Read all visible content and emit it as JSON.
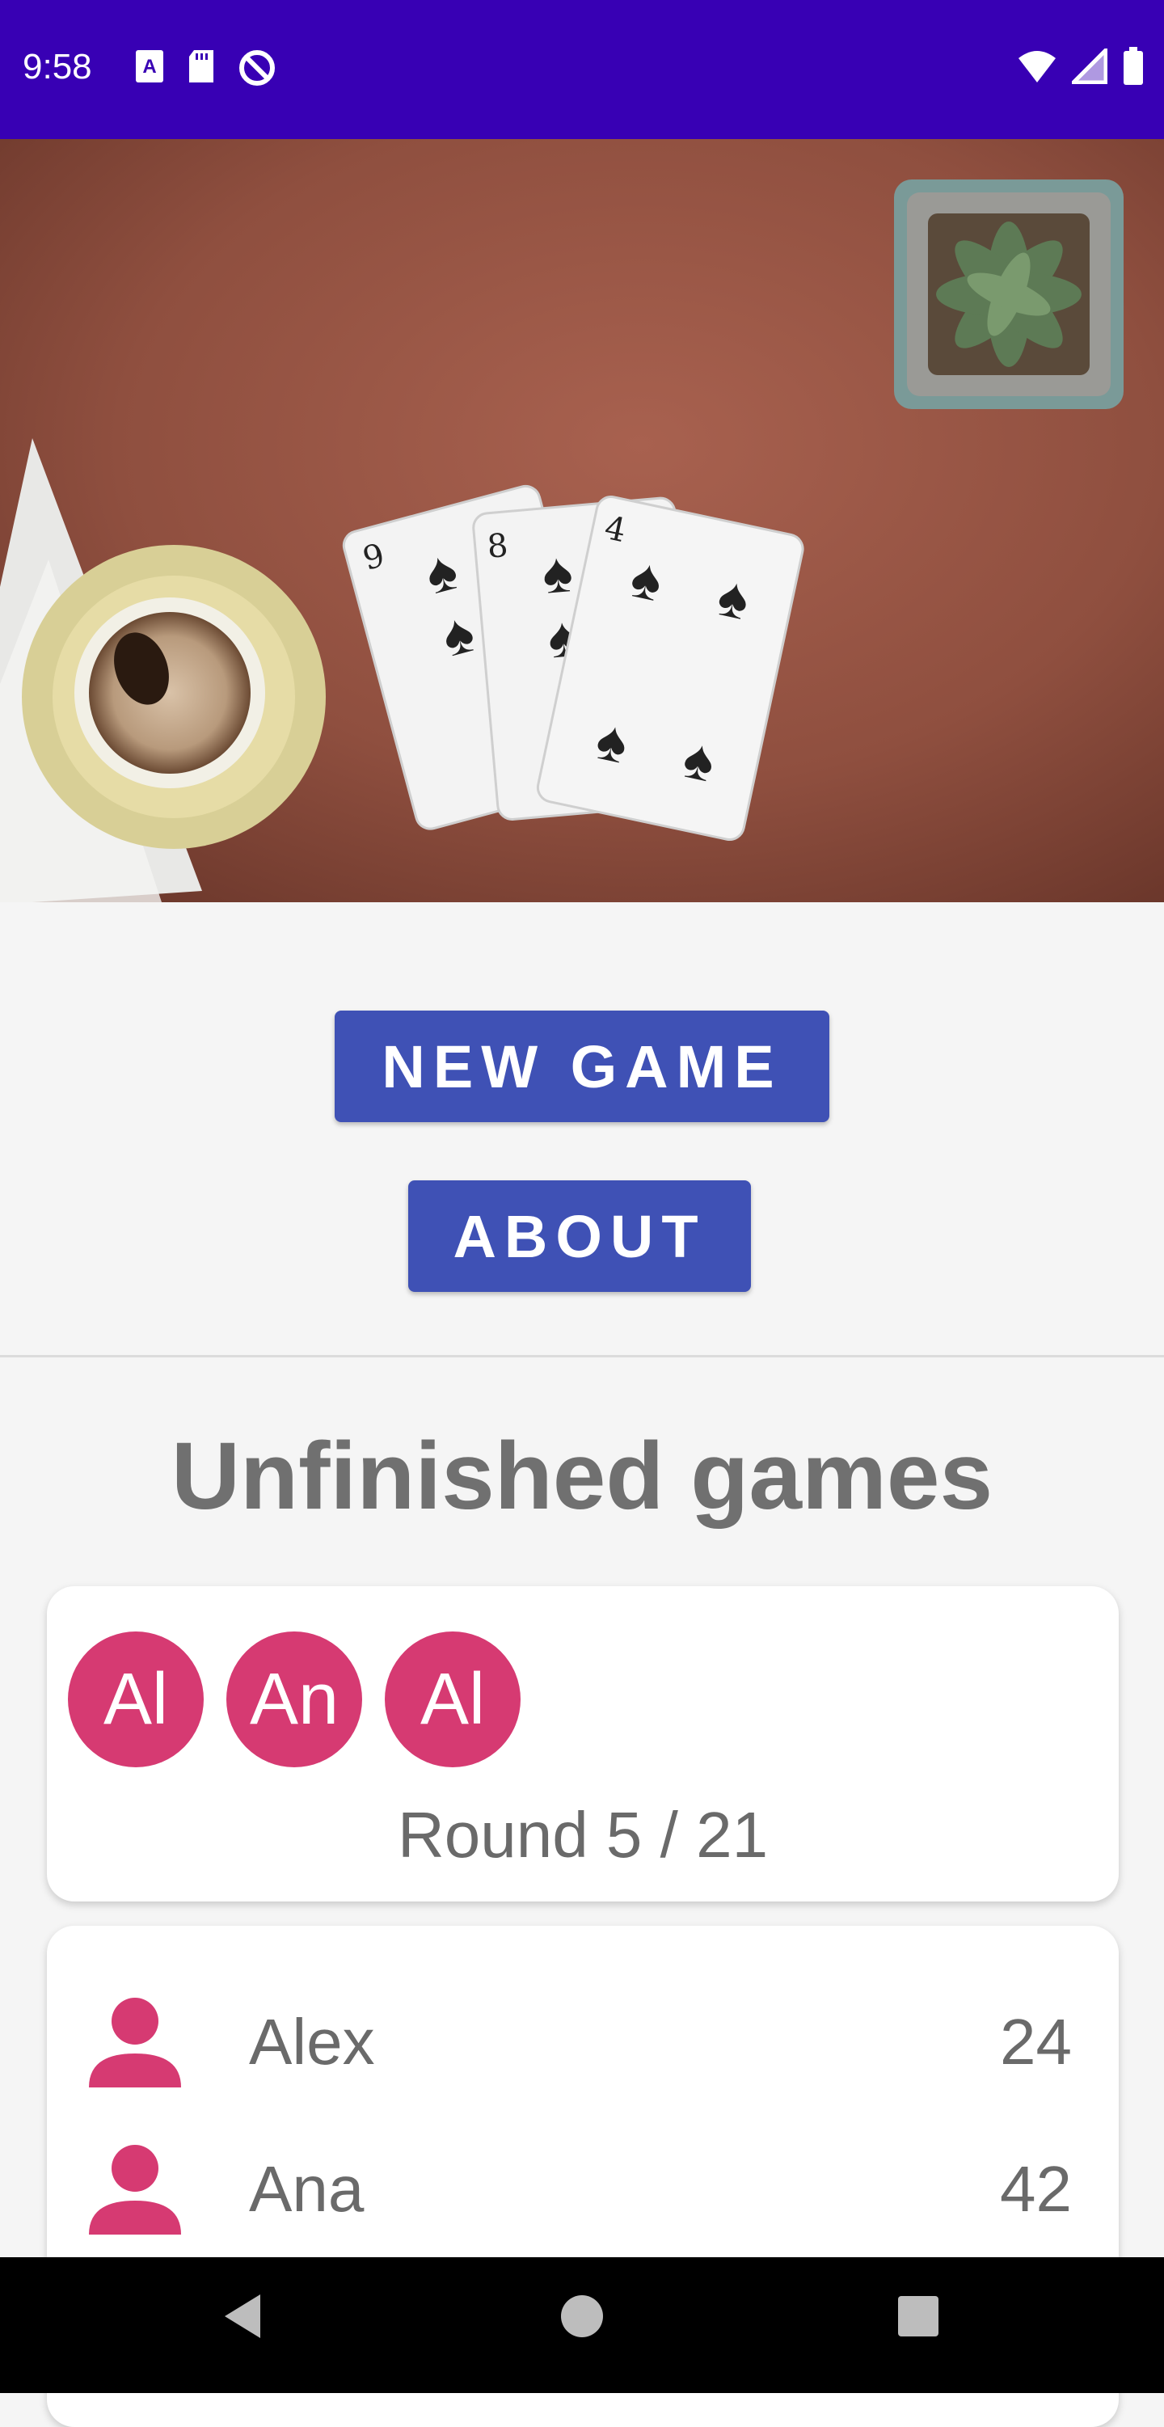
{
  "status_bar": {
    "time": "9:58",
    "left_icons": [
      "keyboard-a-icon",
      "sd-card-icon",
      "do-not-disturb-icon"
    ],
    "right_icons": [
      "wifi-icon",
      "cell-signal-icon",
      "battery-icon"
    ],
    "background_color": "#3800b4"
  },
  "hero": {
    "description": "card-table-photo"
  },
  "actions": {
    "new_game_label": "NEW GAME",
    "about_label": "ABOUT",
    "button_color": "#3f51b5"
  },
  "unfinished": {
    "title": "Unfinished games",
    "game_card": {
      "avatars": [
        "Al",
        "An",
        "Al"
      ],
      "round_text": "Round 5 / 21",
      "accent_color": "#d63a72"
    },
    "players": [
      {
        "name": "Alex",
        "score": "24"
      },
      {
        "name": "Ana",
        "score": "42"
      }
    ]
  },
  "nav_bar": {
    "buttons": [
      "back-icon",
      "home-icon",
      "recents-icon"
    ]
  }
}
